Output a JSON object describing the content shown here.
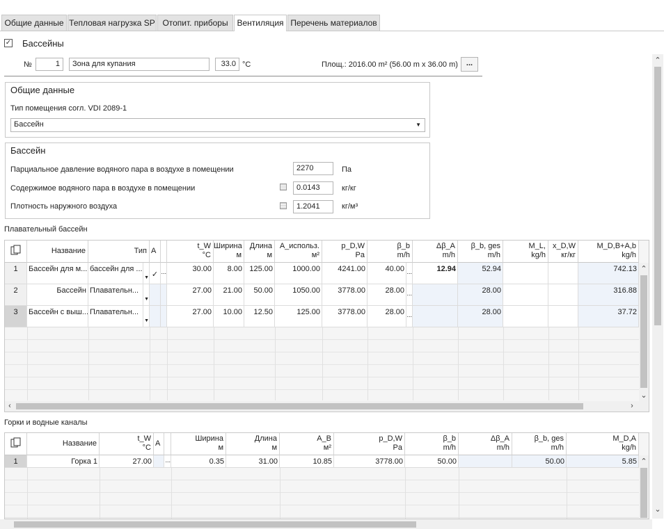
{
  "tabs": [
    {
      "label": "Общие данные"
    },
    {
      "label": "Тепловая нагрузка SP"
    },
    {
      "label": "Отопит. приборы"
    },
    {
      "label": "Вентиляция"
    },
    {
      "label": "Перечень материалов"
    }
  ],
  "active_tab": "Вентиляция",
  "pools_section": {
    "checkbox_label": "Бассейны",
    "checked": true,
    "number_label": "№",
    "number_value": "1",
    "zone_name": "Зона для купания",
    "temperature_value": "33.0",
    "temperature_unit": "°C",
    "area_text": "Площ.: 2016.00  m² (56.00 m x 36.00 m)",
    "more_button": "..."
  },
  "general": {
    "title": "Общие данные",
    "room_type_label": "Тип помещения согл. VDI 2089-1",
    "room_type_value": "Бассейн"
  },
  "pool": {
    "title": "Бассейн",
    "rows": [
      {
        "label": "Парциальное давление водяного пара в воздухе в помещении",
        "value": "2270",
        "unit": "Па"
      },
      {
        "label": "Содержимое водяного пара в воздухе в помещении",
        "value": "0.0143",
        "unit": "кг/кг"
      },
      {
        "label": "Плотность наружного воздуха",
        "value": "1.2041",
        "unit": "кг/м³"
      }
    ]
  },
  "swimming_table": {
    "title": "Плавательный бассейн",
    "headers": [
      {
        "l1": "Название",
        "l2": ""
      },
      {
        "l1": "Тип",
        "l2": ""
      },
      {
        "l1": "A",
        "l2": ""
      },
      {
        "l1": "",
        "l2": ""
      },
      {
        "l1": "t_W",
        "l2": "°C"
      },
      {
        "l1": "Ширина",
        "l2": "м"
      },
      {
        "l1": "Длина",
        "l2": "м"
      },
      {
        "l1": "A_использ.",
        "l2": "м²"
      },
      {
        "l1": "p_D,W",
        "l2": "Pa"
      },
      {
        "l1": "β_b",
        "l2": "m/h"
      },
      {
        "l1": "Δβ_A",
        "l2": "m/h"
      },
      {
        "l1": "β_b, ges",
        "l2": "m/h"
      },
      {
        "l1": "M_L,",
        "l2": "kg/h"
      },
      {
        "l1": "x_D,W",
        "l2": "кг/кг"
      },
      {
        "l1": "M_D,B+A,b",
        "l2": "kg/h"
      }
    ],
    "rows": [
      {
        "n": "1",
        "name": "Бассейн для м...",
        "type": "бассейн для ...",
        "a": "✓",
        "tw": "30.00",
        "width": "8.00",
        "length": "125.00",
        "area": "1000.00",
        "pdw": "4241.00",
        "bb": "40.00",
        "dba": "12.94",
        "bges": "52.94",
        "ml": "",
        "xdw": "",
        "md": "742.13"
      },
      {
        "n": "2",
        "name": "Бассейн",
        "type": "Плавательн...",
        "a": "",
        "tw": "27.00",
        "width": "21.00",
        "length": "50.00",
        "area": "1050.00",
        "pdw": "3778.00",
        "bb": "28.00",
        "dba": "",
        "bges": "28.00",
        "ml": "",
        "xdw": "",
        "md": "316.88"
      },
      {
        "n": "3",
        "name": "Бассейн с выш...",
        "type": "Плавательн...",
        "a": "",
        "tw": "27.00",
        "width": "10.00",
        "length": "12.50",
        "area": "125.00",
        "pdw": "3778.00",
        "bb": "28.00",
        "dba": "",
        "bges": "28.00",
        "ml": "",
        "xdw": "",
        "md": "37.72"
      }
    ]
  },
  "slides_table": {
    "title": "Горки и водные каналы",
    "headers": [
      {
        "l1": "Название",
        "l2": ""
      },
      {
        "l1": "t_W",
        "l2": "°C"
      },
      {
        "l1": "A",
        "l2": ""
      },
      {
        "l1": "",
        "l2": ""
      },
      {
        "l1": "Ширина",
        "l2": "м"
      },
      {
        "l1": "Длина",
        "l2": "м"
      },
      {
        "l1": "A_B",
        "l2": "м²"
      },
      {
        "l1": "p_D,W",
        "l2": "Pa"
      },
      {
        "l1": "β_b",
        "l2": "m/h"
      },
      {
        "l1": "Δβ_A",
        "l2": "m/h"
      },
      {
        "l1": "β_b, ges",
        "l2": "m/h"
      },
      {
        "l1": "M_D,A",
        "l2": "kg/h"
      }
    ],
    "rows": [
      {
        "n": "1",
        "name": "Горка 1",
        "tw": "27.00",
        "width": "0.35",
        "length": "31.00",
        "ab": "10.85",
        "pdw": "3778.00",
        "bb": "50.00",
        "dba": "",
        "bges": "50.00",
        "md": "5.85"
      }
    ]
  },
  "colors": {
    "shaded_cell": "#eef3fa",
    "tab_bg": "#e3e3e3",
    "border": "#c8c8c8"
  }
}
